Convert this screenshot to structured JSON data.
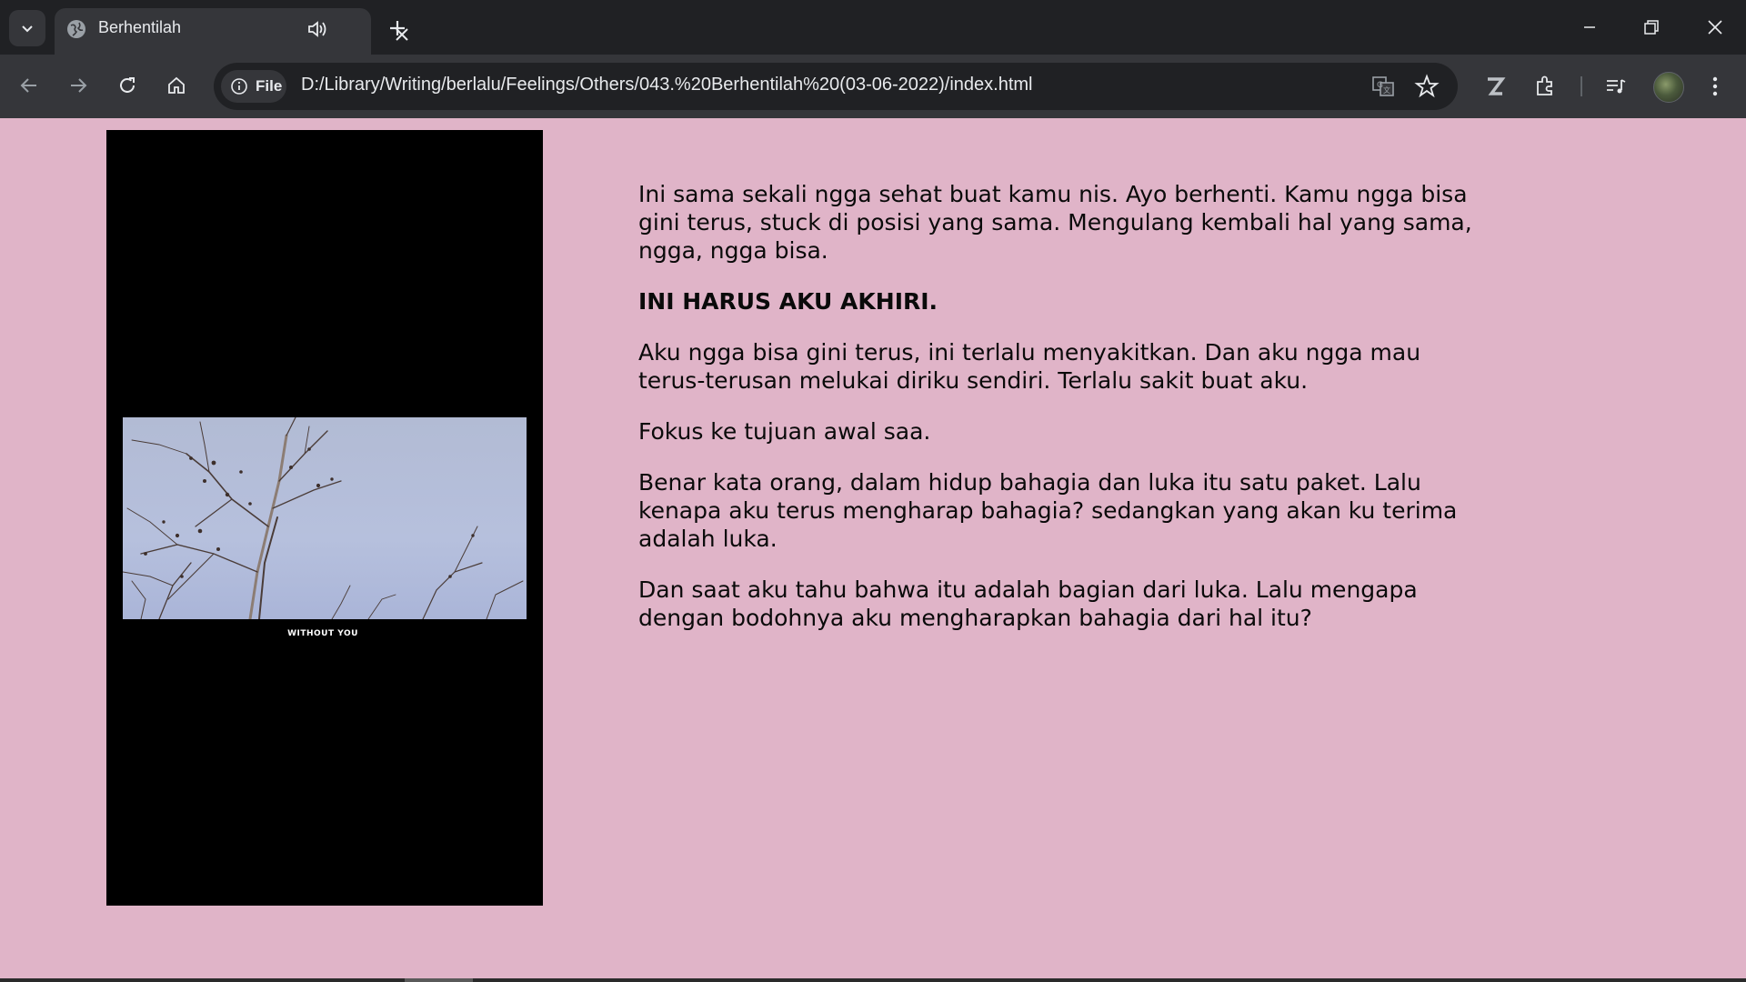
{
  "browser": {
    "tab_title": "Berhentilah",
    "site_chip_label": "File",
    "url": "D:/Library/Writing/berlalu/Feelings/Others/043.%20Berhentilah%20(03-06-2022)/index.html",
    "icons": {
      "tab_search": "chevron-down-icon",
      "favicon": "globe-icon",
      "audio": "speaker-icon",
      "close_tab": "close-icon",
      "new_tab": "plus-icon",
      "minimize": "minimize-icon",
      "restore": "restore-icon",
      "close_window": "close-icon",
      "back": "back-arrow-icon",
      "forward": "forward-arrow-icon",
      "reload": "reload-icon",
      "home": "home-icon",
      "site_info": "info-icon",
      "translate": "translate-icon",
      "bookmark": "star-icon",
      "z_extension": "z-extension-icon",
      "extensions": "puzzle-icon",
      "media": "media-controls-icon",
      "menu": "kebab-menu-icon"
    },
    "colors": {
      "titlebar": "#202124",
      "toolbar": "#35363a",
      "page_background": "#e0b4c8"
    }
  },
  "page": {
    "video": {
      "caption": "WITHOUT YOU"
    },
    "paragraphs": [
      "Ini sama sekali ngga sehat buat kamu nis. Ayo berhenti. Kamu ngga bisa gini terus, stuck di posisi yang sama. Mengulang kembali hal yang sama, ngga, ngga bisa.",
      "INI HARUS AKU AKHIRI.",
      "Aku ngga bisa gini terus, ini terlalu menyakitkan. Dan aku ngga mau terus-terusan melukai diriku sendiri. Terlalu sakit buat aku.",
      "Fokus ke tujuan awal saa.",
      "Benar kata orang, dalam hidup bahagia dan luka itu satu paket. Lalu kenapa aku terus mengharap bahagia? sedangkan yang akan ku terima adalah luka.",
      "Dan saat aku tahu bahwa itu adalah bagian dari luka. Lalu mengapa dengan bodohnya aku mengharapkan bahagia dari hal itu?"
    ]
  }
}
